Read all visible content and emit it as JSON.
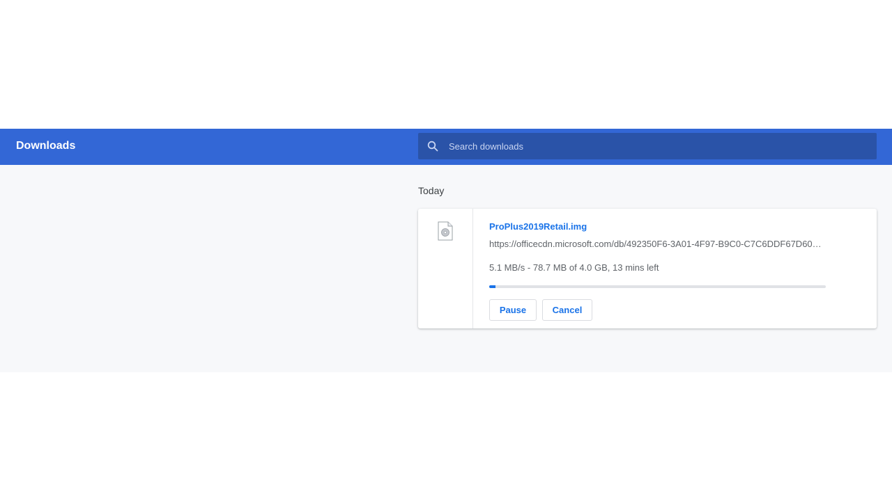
{
  "header": {
    "title": "Downloads",
    "search_placeholder": "Search downloads",
    "search_value": "",
    "color": "#3367d6"
  },
  "section": {
    "date_label": "Today"
  },
  "download": {
    "icon": "disc-image-file-icon",
    "file_name": "ProPlus2019Retail.img",
    "url": "https://officecdn.microsoft.com/db/492350F6-3A01-4F97-B9C0-C7C6DDF67D60/m...",
    "status": "5.1 MB/s - 78.7 MB of 4.0 GB, 13 mins left",
    "progress_fraction": 0.019,
    "actions": {
      "pause_label": "Pause",
      "cancel_label": "Cancel"
    },
    "accent": "#1a73e8"
  }
}
